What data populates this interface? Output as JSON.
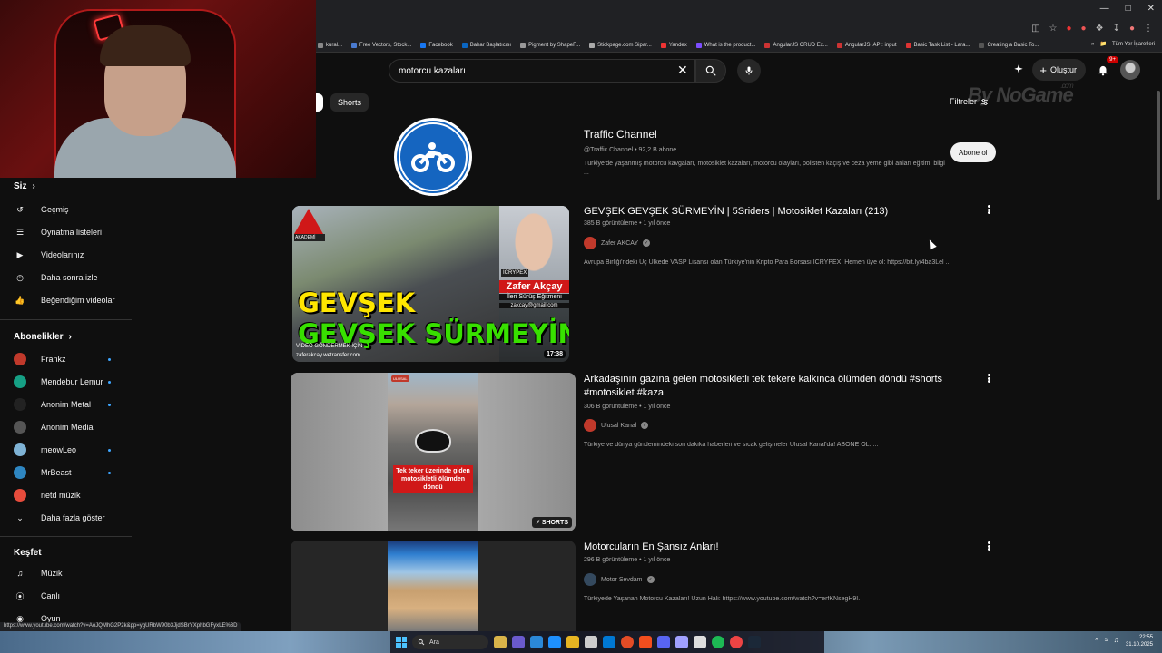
{
  "bookmarks": [
    "kural...",
    "Free Vectors, Stock...",
    "Facebook",
    "Bahar Başlatıcısı",
    "Pigment by ShapeF...",
    "Stickpage.com Sipar...",
    "Yandex",
    "What is the product...",
    "AngularJS CRUD Ex...",
    "AngularJS: API: input",
    "Basic Task List - Lara...",
    "Creating a Basic To..."
  ],
  "bookmarks_all": "Tüm Yer İşaretleri",
  "search": {
    "query": "motorcu kazaları"
  },
  "header": {
    "create_label": "Oluştur",
    "notif_count": "9+"
  },
  "chips": {
    "shorts": "Shorts",
    "filters": "Filtreler"
  },
  "watermark": {
    "text": "By NoGame",
    "domain": ".com"
  },
  "sidebar": {
    "you_title": "Siz",
    "you_items": [
      {
        "label": "Geçmiş",
        "icon": "history-icon"
      },
      {
        "label": "Oynatma listeleri",
        "icon": "playlist-icon"
      },
      {
        "label": "Videolarınız",
        "icon": "your-videos-icon"
      },
      {
        "label": "Daha sonra izle",
        "icon": "watch-later-icon"
      },
      {
        "label": "Beğendiğim videolar",
        "icon": "like-icon"
      }
    ],
    "subs_title": "Abonelikler",
    "subscriptions": [
      {
        "label": "Frankz",
        "color": "#c0392b",
        "new": true
      },
      {
        "label": "Mendebur Lemur",
        "color": "#16a085",
        "new": true
      },
      {
        "label": "Anonim Metal",
        "color": "#222222",
        "new": true
      },
      {
        "label": "Anonim Media",
        "color": "#555555",
        "new": false
      },
      {
        "label": "meowLeo",
        "color": "#7fb3d5",
        "new": true
      },
      {
        "label": "MrBeast",
        "color": "#2e86c1",
        "new": true
      },
      {
        "label": "netd müzik",
        "color": "#e74c3c",
        "new": false
      }
    ],
    "show_more": "Daha fazla göster",
    "explore_title": "Keşfet",
    "explore_items": [
      {
        "label": "Müzik",
        "icon": "music-icon"
      },
      {
        "label": "Canlı",
        "icon": "live-icon"
      },
      {
        "label": "Oyun",
        "icon": "gaming-icon"
      }
    ]
  },
  "channel": {
    "name": "Traffic Channel",
    "meta": "@Traffic.Channel • 92,2 B abone",
    "desc": "Türkiye'de yaşanmış motorcu kavgaları, motosiklet kazaları, motorcu olayları, polisten kaçış ve ceza yeme gibi anları eğitim, bilgi ...",
    "subscribe": "Abone ol"
  },
  "videos": [
    {
      "title": "GEVŞEK GEVŞEK SÜRMEYİN | 5Sriders | Motosiklet Kazaları (213)",
      "meta": "385 B görüntüleme • 1 yıl önce",
      "channel": "Zafer AKCAY",
      "desc": "Avrupa Birliği'ndeki Üç Ülkede VASP Lisansı olan Türkiye'nin Kripto Para Borsası ICRYPEX! Hemen üye ol: https://bit.ly/4ba3Lel ...",
      "duration": "17:38",
      "thumb_text1": "GEVŞEK",
      "thumb_text2": "GEVŞEK SÜRMEYİN",
      "thumb_name": "Zafer Akçay",
      "thumb_role": "İleri Sürüş Eğitmeni",
      "thumb_mail": "zakcay@gmail.com",
      "thumb_brand": "ICRYPEX",
      "thumb_logo": "AKADEMİ",
      "thumb_footer": "VİDEO GÖNDERMEK İÇİN",
      "thumb_footer2": "zaferakcay.wetransfer.com",
      "channel_color": "#c0392b"
    },
    {
      "title": "Arkadaşının gazına gelen motosikletli tek tekere kalkınca ölümden döndü #shorts #motosiklet #kaza",
      "meta": "306 B görüntüleme • 1 yıl önce",
      "channel": "Ulusal Kanal",
      "desc": "Türkiye ve dünya gündemindeki son dakika haberleri ve sıcak gelişmeler Ulusal Kanal'da! ABONE OL: ...",
      "badge": "SHORTS",
      "thumb_caption": "Tek teker üzerinde giden motosikletli ölümden döndü",
      "thumb_logo": "ULUSAL",
      "channel_color": "#c0392b"
    },
    {
      "title": "Motorcuların En Şansız Anları!",
      "meta": "296 B görüntüleme • 1 yıl önce",
      "channel": "Motor Sevdam",
      "desc": "Türkiyede Yaşanan Motorcu Kazaları! Uzun Hali: https://www.youtube.com/watch?v=erfKNsegH9I.",
      "channel_color": "#34495e"
    }
  ],
  "status_url": "https://www.youtube.com/watch?v=AoJQMhG2P2k&pp=ygURbW90b3JjdSBrYXphbGFyxLE%3D",
  "taskbar": {
    "search_label": "Ara",
    "time": "22:55",
    "date": "31.10.2025"
  }
}
